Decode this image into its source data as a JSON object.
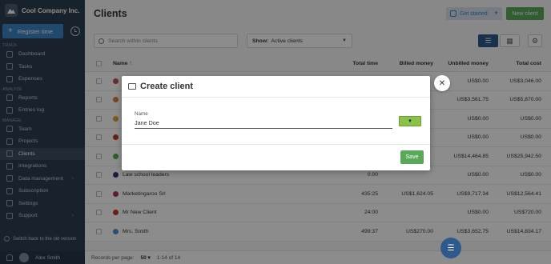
{
  "sidebar": {
    "brand": "Cool Company Inc.",
    "register_label": "Register time",
    "sections": [
      {
        "label": "TRACK",
        "items": [
          {
            "label": "Dashboard"
          },
          {
            "label": "Tasks"
          },
          {
            "label": "Expenses"
          }
        ]
      },
      {
        "label": "ANALYZE",
        "items": [
          {
            "label": "Reports"
          },
          {
            "label": "Entries log"
          }
        ]
      },
      {
        "label": "MANAGE",
        "items": [
          {
            "label": "Team"
          },
          {
            "label": "Projects"
          },
          {
            "label": "Clients"
          },
          {
            "label": "Integrations"
          },
          {
            "label": "Data management"
          },
          {
            "label": "Subscription"
          },
          {
            "label": "Settings"
          },
          {
            "label": "Support"
          }
        ]
      }
    ],
    "active_item": "Clients",
    "switch_old": "Switch back to the old version",
    "user_name": "Alex Smith"
  },
  "header": {
    "title": "Clients",
    "get_started": "Get started",
    "new_client": "New client"
  },
  "filters": {
    "search_placeholder": "Search within clients",
    "show_label": "Show:",
    "show_value": "Active clients"
  },
  "table": {
    "columns": {
      "name": "Name ↑",
      "time": "Total time",
      "billed": "Billed money",
      "unbilled": "Unbilled money",
      "cost": "Total cost"
    },
    "rows": [
      {
        "name": "",
        "color": "#c0504d",
        "time": "",
        "billed": "",
        "unbilled": "US$0.00",
        "cost": "US$3,046.00"
      },
      {
        "name": "",
        "color": "#e07b39",
        "time": "",
        "billed": "",
        "unbilled": "US$3,561.75",
        "cost": "US$5,870.00"
      },
      {
        "name": "",
        "color": "#e0a030",
        "time": "",
        "billed": "",
        "unbilled": "US$0.00",
        "cost": "US$0.00"
      },
      {
        "name": "",
        "color": "#c0392b",
        "time": "",
        "billed": "",
        "unbilled": "US$0.00",
        "cost": "US$0.00"
      },
      {
        "name": "",
        "color": "#4caf50",
        "time": "",
        "billed": "",
        "unbilled": "US$14,464.85",
        "cost": "US$25,942.50"
      },
      {
        "name": "Law school leaders",
        "color": "#4a2a7a",
        "time": "0.00",
        "billed": "",
        "unbilled": "US$0.00",
        "cost": "US$0.00"
      },
      {
        "name": "Marketingaroo Srl",
        "color": "#b03050",
        "time": "435:25",
        "billed": "US$1,624.05",
        "unbilled": "US$9,717.34",
        "cost": "US$12,564.41"
      },
      {
        "name": "Mr New Client",
        "color": "#c0392b",
        "time": "24:00",
        "billed": "",
        "unbilled": "US$0.00",
        "cost": "US$720.00"
      },
      {
        "name": "Mrs. Smith",
        "color": "#4a90d9",
        "time": "499:37",
        "billed": "US$270.00",
        "unbilled": "US$3,652.75",
        "cost": "US$14,834.17"
      }
    ]
  },
  "footer": {
    "records_label": "Records per page:",
    "per_page": "50",
    "range": "1-14 of 14"
  },
  "modal": {
    "title": "Create client",
    "name_label": "Name",
    "name_value": "Jane Doe",
    "save_label": "Save"
  }
}
